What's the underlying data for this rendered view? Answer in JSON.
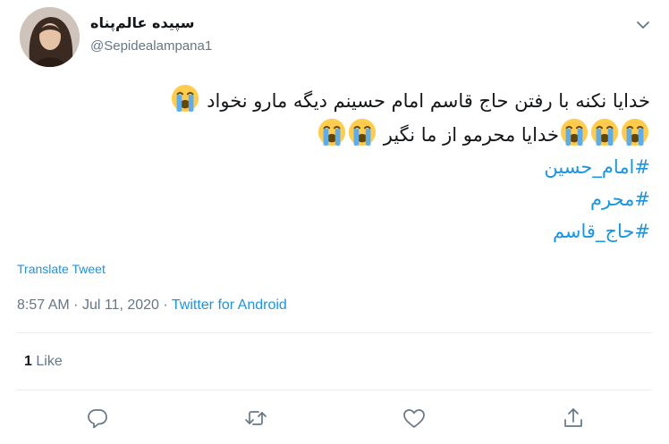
{
  "user": {
    "name": "سپیده عالم‌پناه",
    "handle": "@Sepidealampana1"
  },
  "tweet": {
    "line1": "خدایا نکنه با رفتن حاج قاسم امام حسینم دیگه مارو نخواد",
    "line2": "خدایا محرمو از ما نگیر",
    "hashtags": [
      "#امام_حسین",
      "#محرم",
      "#حاج_قاسم"
    ],
    "emoji_name": "loudly-crying-face"
  },
  "translate_label": "Translate Tweet",
  "meta": {
    "time": "8:57 AM",
    "date": "Jul 11, 2020",
    "separator": "·",
    "source": "Twitter for Android"
  },
  "stats": {
    "likes_count": "1",
    "likes_label": "Like"
  },
  "actions": [
    "reply-icon",
    "retweet-icon",
    "like-icon",
    "share-icon"
  ],
  "colors": {
    "link": "#1b95e0",
    "secondary_text": "#657786",
    "divider": "#e6ecf0"
  }
}
